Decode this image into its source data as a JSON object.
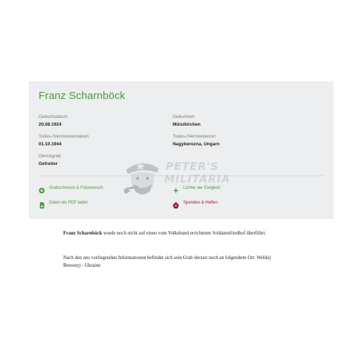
{
  "record": {
    "name": "Franz Scharnböck",
    "fields": {
      "birth_date": {
        "label": "Geburtsdatum",
        "value": "20.08.1924"
      },
      "birth_place": {
        "label": "Geburtsort",
        "value": "Münzkirchen"
      },
      "death_date": {
        "label": "Todes-/Vermisstendatum",
        "value": "01.10.1944"
      },
      "death_place": {
        "label": "Todes-/Vermisstenort",
        "value": "Nagyberezna, Ungarn"
      },
      "rank": {
        "label": "Dienstgrad",
        "value": "Gefreiter"
      }
    },
    "actions": {
      "grave_decoration": "Grabschmuck & Fotowunsch",
      "light_eternity": "Lichter der Ewigkeit",
      "pdf": "Daten als PDF laden",
      "donate": "Spenden & Helfen"
    }
  },
  "watermark": {
    "line1": "PETER'S",
    "line2": "MILITARIA"
  },
  "text": {
    "p1_name": "Franz Scharnböck",
    "p1_rest": " wurde noch nicht auf einen vom Volksbund errichteten Soldatenfriedhof überführt.",
    "p2": "Nach den uns vorliegenden Informationen befindet sich sein Grab derzeit noch an folgendem Ort: Welikij Beresnyj - Ukraine"
  },
  "colors": {
    "green": "#4c9a3c",
    "red": "#a11a3b",
    "card_bg": "#eceeef"
  }
}
